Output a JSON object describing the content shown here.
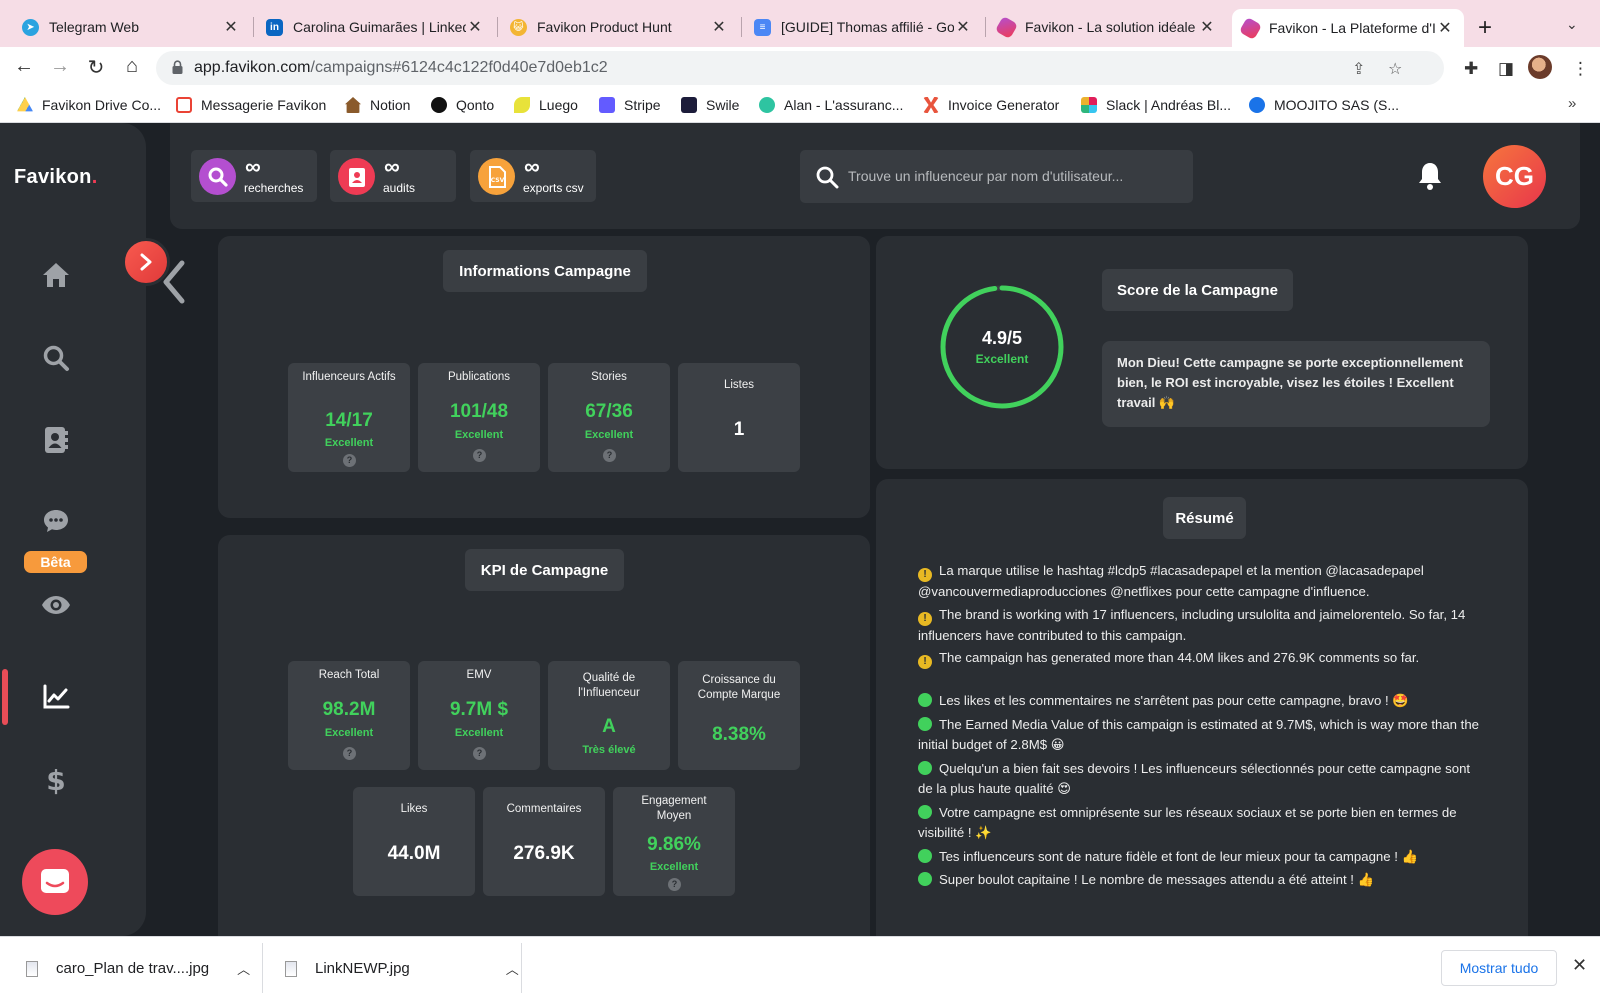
{
  "browser": {
    "tabs": [
      {
        "title": "Telegram Web",
        "color": "#2aa3e0",
        "active": false
      },
      {
        "title": "Carolina Guimarães | LinkedIn",
        "color": "#0a66c2",
        "active": false
      },
      {
        "title": "Favikon Product Hunt",
        "color": "#f3b533",
        "active": false
      },
      {
        "title": "[GUIDE] Thomas affilié - Google Docs",
        "color": "#4b87f5",
        "active": false
      },
      {
        "title": "Favikon - La solution idéale",
        "color": "#e8365b",
        "active": false
      },
      {
        "title": "Favikon - La Plateforme d'Influence",
        "color": "#e8365b",
        "active": true
      }
    ],
    "url_host": "app.favikon.com",
    "url_path": "/campaigns#6124c4c122f0d40e7d0eb1c2",
    "bookmarks": [
      {
        "label": "Favikon Drive Co...",
        "color": "#1fa463"
      },
      {
        "label": "Messagerie Favikon",
        "color": "#ea4335"
      },
      {
        "label": "Notion",
        "color": "#8a5a2b"
      },
      {
        "label": "Qonto",
        "color": "#111111"
      },
      {
        "label": "Luego",
        "color": "#e8e23a"
      },
      {
        "label": "Stripe",
        "color": "#635bff"
      },
      {
        "label": "Swile",
        "color": "#1c1c3a"
      },
      {
        "label": "Alan - L'assuranc...",
        "color": "#2ec4a1"
      },
      {
        "label": "Invoice Generator",
        "color": "#e8543d"
      },
      {
        "label": "Slack | Andréas Bl...",
        "color": "#e01e5a"
      },
      {
        "label": "MOOJITO SAS (S...",
        "color": "#1a73e8"
      }
    ]
  },
  "app": {
    "brand": "Favikon",
    "brand_dot": ".",
    "beta_badge": "Bêta",
    "quotas": [
      {
        "value": "∞",
        "label": "recherches",
        "color": "#b44fd0"
      },
      {
        "value": "∞",
        "label": "audits",
        "color": "#ef3b54"
      },
      {
        "value": "∞",
        "label": "exports csv",
        "color": "#f7a23b"
      }
    ],
    "search_placeholder": "Trouve un influenceur par nom d'utilisateur...",
    "avatar_initials": "CG",
    "info_title": "Informations Campagne",
    "info_cards": [
      {
        "label": "Influenceurs Actifs",
        "value": "14/17",
        "status": "Excellent"
      },
      {
        "label": "Publications",
        "value": "101/48",
        "status": "Excellent"
      },
      {
        "label": "Stories",
        "value": "67/36",
        "status": "Excellent"
      },
      {
        "label": "Listes",
        "value": "1",
        "status": ""
      }
    ],
    "kpi_title": "KPI de Campagne",
    "kpi_cards": [
      {
        "label": "Reach Total",
        "value": "98.2M",
        "status": "Excellent"
      },
      {
        "label": "EMV",
        "value": "9.7M $",
        "status": "Excellent"
      },
      {
        "label": "Qualité de l'Influenceur",
        "value": "A",
        "status": "Très élevé"
      },
      {
        "label": "Croissance du Compte Marque",
        "value": "8.38%",
        "status": ""
      },
      {
        "label": "Likes",
        "value": "44.0M",
        "status": ""
      },
      {
        "label": "Commentaires",
        "value": "276.9K",
        "status": ""
      },
      {
        "label": "Engagement Moyen",
        "value": "9.86%",
        "status": "Excellent"
      }
    ],
    "score_title": "Score de la Campagne",
    "score_value": "4.9/5",
    "score_level": 0.98,
    "score_label": "Excellent",
    "score_message": "Mon Dieu! Cette campagne se porte exceptionnellement bien, le ROI est incroyable, visez les étoiles ! Excellent travail 🙌",
    "summary_title": "Résumé",
    "summary_info": [
      "La marque utilise le hashtag #lcdp5 #lacasadepapel et la mention @lacasadepapel @vancouvermediaproducciones @netflixes pour cette campagne d'influence.",
      "The brand is working with 17 influencers, including ursulolita and jaimelorentelo. So far, 14 influencers have contributed to this campaign.",
      "The campaign has generated more than 44.0M likes and 276.9K comments so far."
    ],
    "summary_ok": [
      "Les likes et les commentaires ne s'arrêtent pas pour cette campagne, bravo ! 🤩",
      "The Earned Media Value of this campaign is estimated at 9.7M$, which is way more than the initial budget of 2.8M$ 😀",
      "Quelqu'un a bien fait ses devoirs ! Les influenceurs sélectionnés pour cette campagne sont de la plus haute qualité 😍",
      "Votre campagne est omniprésente sur les réseaux sociaux et se porte bien en termes de visibilité ! ✨",
      "Tes influenceurs sont de nature fidèle et font de leur mieux pour ta campagne ! 👍",
      "Super boulot capitaine ! Le nombre de messages attendu a été atteint ! 👍"
    ]
  },
  "downloads": {
    "items": [
      "caro_Plan de trav....jpg",
      "LinkNEWP.jpg"
    ],
    "show_all": "Mostrar tudo"
  }
}
